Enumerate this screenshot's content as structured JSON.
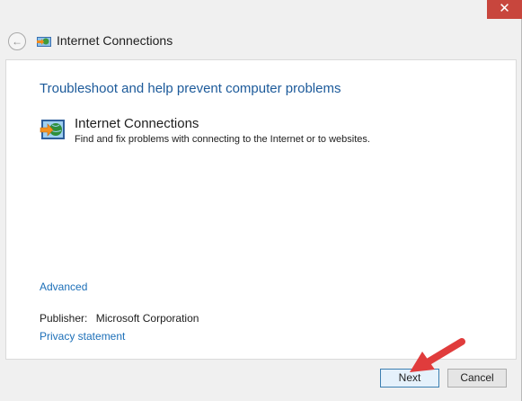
{
  "window": {
    "close_label": "✕",
    "title": "Internet Connections"
  },
  "main": {
    "heading": "Troubleshoot and help prevent computer problems",
    "item": {
      "title": "Internet Connections",
      "description": "Find and fix problems with connecting to the Internet or to websites."
    },
    "advanced_link": "Advanced",
    "publisher_label": "Publisher:",
    "publisher_value": "Microsoft Corporation",
    "privacy_link": "Privacy statement"
  },
  "footer": {
    "next_label": "Next",
    "cancel_label": "Cancel"
  },
  "colors": {
    "heading": "#1c5a9a",
    "link": "#1c6fb8",
    "close": "#c8463d",
    "annotation_arrow": "#e03c3c"
  }
}
